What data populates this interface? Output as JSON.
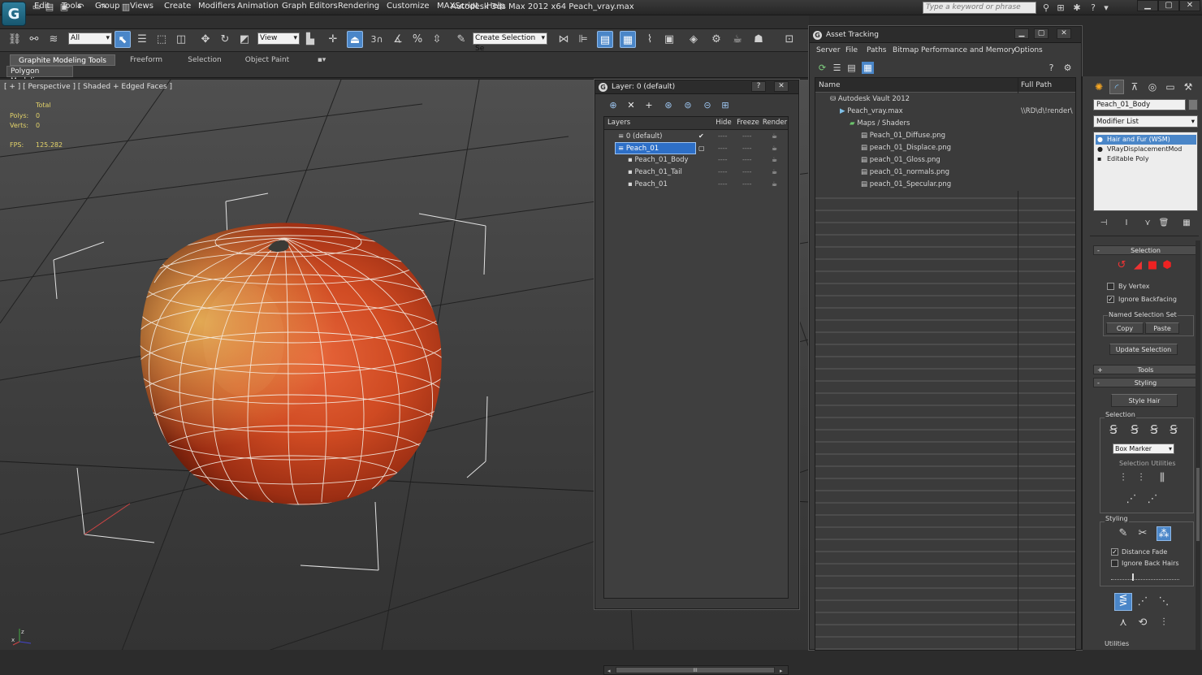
{
  "app": {
    "title": "Autodesk 3ds Max  2012 x64      Peach_vray.max",
    "keyword_search_placeholder": "Type a keyword or phrase"
  },
  "menubar": [
    "Edit",
    "Tools",
    "Group",
    "Views",
    "Create",
    "Modifiers",
    "Animation",
    "Graph Editors",
    "Rendering",
    "Customize",
    "MAXScript",
    "Help"
  ],
  "toolbar": {
    "selection_filter": "All",
    "reference_coord": "View",
    "named_selection_set": "Create Selection Se",
    "snap_label": "3"
  },
  "ribbon": {
    "tabs": [
      "Graphite Modeling Tools",
      "Freeform",
      "Selection",
      "Object Paint"
    ],
    "panel_label": "Polygon Modeling"
  },
  "viewport": {
    "label": "[ + ] [ Perspective ] [ Shaded + Edged Faces ]",
    "stats": {
      "total_header": "Total",
      "polys_label": "Polys:",
      "polys_value": "0",
      "verts_label": "Verts:",
      "verts_value": "0",
      "fps_label": "FPS:",
      "fps_value": "125.282"
    }
  },
  "layer_dialog": {
    "title": "Layer: 0 (default)",
    "columns": {
      "layers": "Layers",
      "hide": "Hide",
      "freeze": "Freeze",
      "render": "Render"
    },
    "rows": [
      {
        "name": "0 (default)"
      },
      {
        "name": "Peach_01"
      },
      {
        "name": "Peach_01_Body"
      },
      {
        "name": "Peach_01_Tail"
      },
      {
        "name": "Peach_01"
      }
    ],
    "scroll_thumb": "III"
  },
  "asset_tracking": {
    "title": "Asset Tracking",
    "menu": [
      "Server",
      "File",
      "Paths",
      "Bitmap Performance and Memory",
      "Options"
    ],
    "columns": {
      "name": "Name",
      "full_path": "Full Path"
    },
    "rows": [
      {
        "name": "Autodesk Vault 2012",
        "path": ""
      },
      {
        "name": "Peach_vray.max",
        "path": "\\\\RD\\d\\!render\\"
      },
      {
        "name": "Maps / Shaders",
        "path": ""
      },
      {
        "name": "Peach_01_Diffuse.png",
        "path": ""
      },
      {
        "name": "peach_01_Displace.png",
        "path": ""
      },
      {
        "name": "peach_01_Gloss.png",
        "path": ""
      },
      {
        "name": "peach_01_normals.png",
        "path": ""
      },
      {
        "name": "peach_01_Specular.png",
        "path": ""
      }
    ]
  },
  "command_panel": {
    "object_name": "Peach_01_Body",
    "modifier_list": "Modifier List",
    "stack": [
      "Hair and Fur (WSM)",
      "VRayDisplacementMod",
      "Editable Poly"
    ],
    "selection_rollout": {
      "title": "Selection",
      "by_vertex": "By Vertex",
      "ignore_backfacing": "Ignore Backfacing",
      "named_sel_group": "Named Selection Set",
      "copy": "Copy",
      "paste": "Paste",
      "update_selection": "Update Selection"
    },
    "tools_rollout": {
      "title": "Tools"
    },
    "styling_rollout": {
      "title": "Styling",
      "style_hair": "Style Hair",
      "selection_group": "Selection",
      "marker": "Box Marker",
      "selection_utilities": "Selection Utilities",
      "styling_group": "Styling",
      "distance_fade": "Distance Fade",
      "ignore_back_hairs": "Ignore Back Hairs",
      "utilities_group": "Utilities"
    }
  },
  "colors": {
    "accent": "#4a86c8",
    "selected_layer": "#2d6fc7",
    "stat_text": "#e3d36a"
  }
}
